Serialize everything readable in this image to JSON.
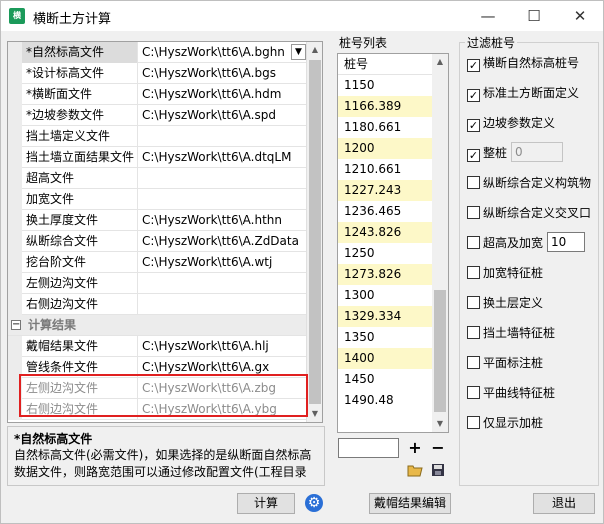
{
  "window": {
    "title": "横断土方计算",
    "icon_text": "横",
    "controls": {
      "minimize": "—",
      "maximize": "☐",
      "close": "✕"
    }
  },
  "property_grid": {
    "rows": [
      {
        "label": "*自然标高文件",
        "value": "C:\\HyszWork\\tt6\\A.bghn",
        "selected": true,
        "dropdown": true
      },
      {
        "label": "*设计标高文件",
        "value": "C:\\HyszWork\\tt6\\A.bgs"
      },
      {
        "label": "*横断面文件",
        "value": "C:\\HyszWork\\tt6\\A.hdm"
      },
      {
        "label": "*边坡参数文件",
        "value": "C:\\HyszWork\\tt6\\A.spd"
      },
      {
        "label": "挡土墙定义文件",
        "value": ""
      },
      {
        "label": "挡土墙立面结果文件",
        "value": "C:\\HyszWork\\tt6\\A.dtqLM"
      },
      {
        "label": "超高文件",
        "value": ""
      },
      {
        "label": "加宽文件",
        "value": ""
      },
      {
        "label": "换土厚度文件",
        "value": "C:\\HyszWork\\tt6\\A.hthn"
      },
      {
        "label": "纵断综合文件",
        "value": "C:\\HyszWork\\tt6\\A.ZdData"
      },
      {
        "label": "挖台阶文件",
        "value": "C:\\HyszWork\\tt6\\A.wtj"
      },
      {
        "label": "左侧边沟文件",
        "value": ""
      },
      {
        "label": "右侧边沟文件",
        "value": ""
      }
    ],
    "category": {
      "toggle": "−",
      "label": "计算结果"
    },
    "result_rows": [
      {
        "label": "戴帽结果文件",
        "value": "C:\\HyszWork\\tt6\\A.hlj"
      },
      {
        "label": "管线条件文件",
        "value": "C:\\HyszWork\\tt6\\A.gx"
      },
      {
        "label": "左侧边沟文件",
        "value": "C:\\HyszWork\\tt6\\A.zbg",
        "dim": true
      },
      {
        "label": "右侧边沟文件",
        "value": "C:\\HyszWork\\tt6\\A.ybg",
        "dim": true
      }
    ]
  },
  "description": {
    "title": "*自然标高文件",
    "text": "自然标高文件(必需文件)，如果选择的是纵断面自然标高数据文件，则路宽范围可以通过修改配置文件(工程目录"
  },
  "station_list": {
    "label": "桩号列表",
    "header": "桩号",
    "items": [
      {
        "value": "1150",
        "hl": false
      },
      {
        "value": "1166.389",
        "hl": true
      },
      {
        "value": "1180.661",
        "hl": false
      },
      {
        "value": "1200",
        "hl": true
      },
      {
        "value": "1210.661",
        "hl": false
      },
      {
        "value": "1227.243",
        "hl": true
      },
      {
        "value": "1236.465",
        "hl": false
      },
      {
        "value": "1243.826",
        "hl": true
      },
      {
        "value": "1250",
        "hl": false
      },
      {
        "value": "1273.826",
        "hl": true
      },
      {
        "value": "1300",
        "hl": false
      },
      {
        "value": "1329.334",
        "hl": true
      },
      {
        "value": "1350",
        "hl": false
      },
      {
        "value": "1400",
        "hl": true
      },
      {
        "value": "1450",
        "hl": false
      },
      {
        "value": "1490.48",
        "hl": false
      }
    ],
    "add_label": "+",
    "remove_label": "−"
  },
  "filter": {
    "title": "过滤桩号",
    "options": [
      {
        "label": "横断自然标高桩号",
        "checked": true
      },
      {
        "label": "标准土方断面定义",
        "checked": true
      },
      {
        "label": "边坡参数定义",
        "checked": true
      },
      {
        "label": "整桩",
        "checked": true
      },
      {
        "label": "纵断综合定义构筑物",
        "checked": false
      },
      {
        "label": "纵断综合定义交叉口",
        "checked": false
      },
      {
        "label": "超高及加宽",
        "checked": false
      },
      {
        "label": "加宽特征桩",
        "checked": false
      },
      {
        "label": "换土层定义",
        "checked": false
      },
      {
        "label": "挡土墙特征桩",
        "checked": false
      },
      {
        "label": "平面标注桩",
        "checked": false
      },
      {
        "label": "平曲线特征桩",
        "checked": false
      },
      {
        "label": "仅显示加桩",
        "checked": false
      }
    ],
    "whole_station_value": "0",
    "superelevation_value": "10"
  },
  "buttons": {
    "calculate": "计算",
    "edit_results": "戴帽结果编辑",
    "exit": "退出"
  },
  "colors": {
    "highlight": "#fdf8c8",
    "red_box": "#e02020",
    "gear": "#2a6fd6"
  }
}
